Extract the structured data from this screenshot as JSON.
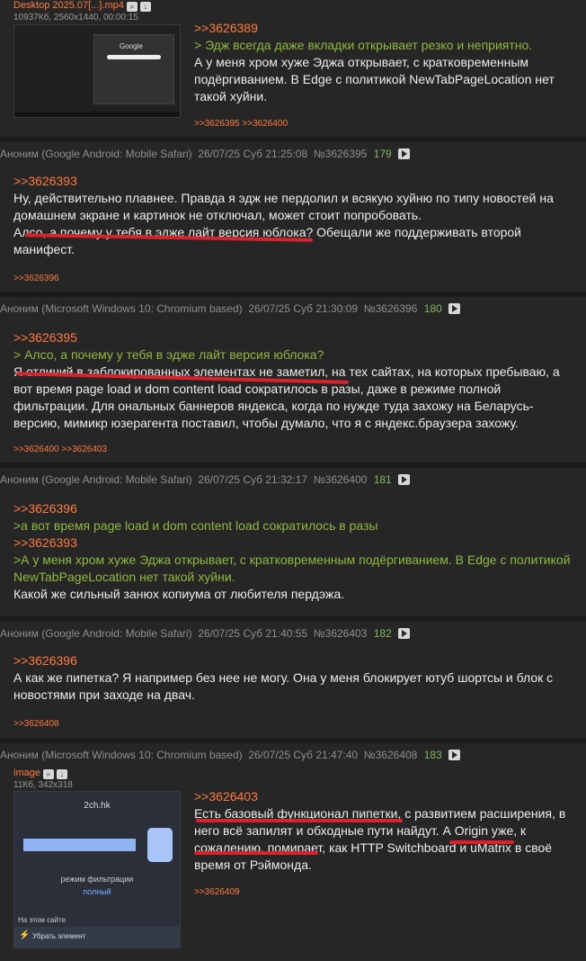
{
  "posts": [
    {
      "file": {
        "name": "Desktop 2025.07[...].mp4",
        "meta": "10937Кб, 2560x1440, 00:00:15",
        "thumb_text": "Google"
      },
      "reply": ">>3626389",
      "quote": "> Эдж всегда даже вкладки открывает резко и неприятно.",
      "text": "А у меня хром хуже Эджа открывает, с кратковременным подёргиванием. В Edge с политикой NewTabPageLocation нет такой хуйни.",
      "refs": ">>3626395 >>3626400"
    },
    {
      "author": "Аноним",
      "ua": "(Google Android: Mobile Safari)",
      "date": "26/07/25 Суб 21:25:08",
      "num": "№3626395",
      "idx": "179",
      "reply": ">>3626393",
      "text": "Ну, действительно плавнее. Правда я эдж не пердолил и всякую хуйню по типу новостей на домашнем экране и картинок не отключал, может стоит попробовать.\nАлсо, а почему у тебя в эдже лайт версия юблока? Обещали же поддерживать второй манифест.",
      "refs": ">>3626396"
    },
    {
      "author": "Аноним",
      "ua": "(Microsoft Windows 10: Chromium based)",
      "date": "26/07/25 Суб 21:30:09",
      "num": "№3626396",
      "idx": "180",
      "reply": ">>3626395",
      "quote": "> Алсо, а почему у тебя в эдже лайт версия юблока?",
      "text": "Я отличий в заблокированных элементах не заметил, на тех сайтах, на которых пребываю, а вот время page load и dom content load сократилось в разы, даже в режиме полной фильтрации. Для ональных баннеров яндекса, когда по нужде туда захожу на Беларусь-версию, мимикр юзерагента поставил, чтобы думало, что я с яндекс.браузера захожу.",
      "refs": ">>3626400 >>3626403"
    },
    {
      "author": "Аноним",
      "ua": "(Google Android: Mobile Safari)",
      "date": "26/07/25 Суб 21:32:17",
      "num": "№3626400",
      "idx": "181",
      "reply": ">>3626396",
      "quote": ">а вот время page load и dom content load сократилось в разы",
      "reply2": ">>3626393",
      "quote2": ">А у меня хром хуже Эджа открывает, с кратковременным подёргиванием. В Edge с политикой NewTabPageLocation нет такой хуйни.",
      "text": "Какой же сильный занюх копиума от любителя пердэжа."
    },
    {
      "author": "Аноним",
      "ua": "(Google Android: Mobile Safari)",
      "date": "26/07/25 Суб 21:40:55",
      "num": "№3626403",
      "idx": "182",
      "reply": ">>3626396",
      "text": "А как же пипетка? Я например без нее не могу. Она у меня блокирует ютуб шортсы и блок с новостями при заходе на двач.",
      "refs": ">>3626408"
    },
    {
      "author": "Аноним",
      "ua": "(Microsoft Windows 10: Chromium based)",
      "date": "26/07/25 Суб 21:47:40",
      "num": "№3626408",
      "idx": "183",
      "file": {
        "name": "image",
        "meta": "11Кб, 342x318",
        "site": "2ch.hk",
        "mode": "режим фильтрации",
        "mode_val": "полный",
        "on_site": "На этом сайте",
        "remove": "Убрать элемент"
      },
      "reply": ">>3626403",
      "text": "Есть базовый функционал пипетки, с развитием расширения, в него всё запилят и обходные пути найдут. А Origin уже, к сожалению, помирает, как HTTP Switchboard и uMatrix в своё время от Рэймонда.",
      "refs": ">>3626409"
    }
  ],
  "colors": {
    "bg": "#1b1b1b",
    "post_bg": "#262626",
    "reply": "#ff7a3f",
    "quote": "#8fb83f",
    "index": "#83b85a",
    "underline": "#d9232c"
  }
}
